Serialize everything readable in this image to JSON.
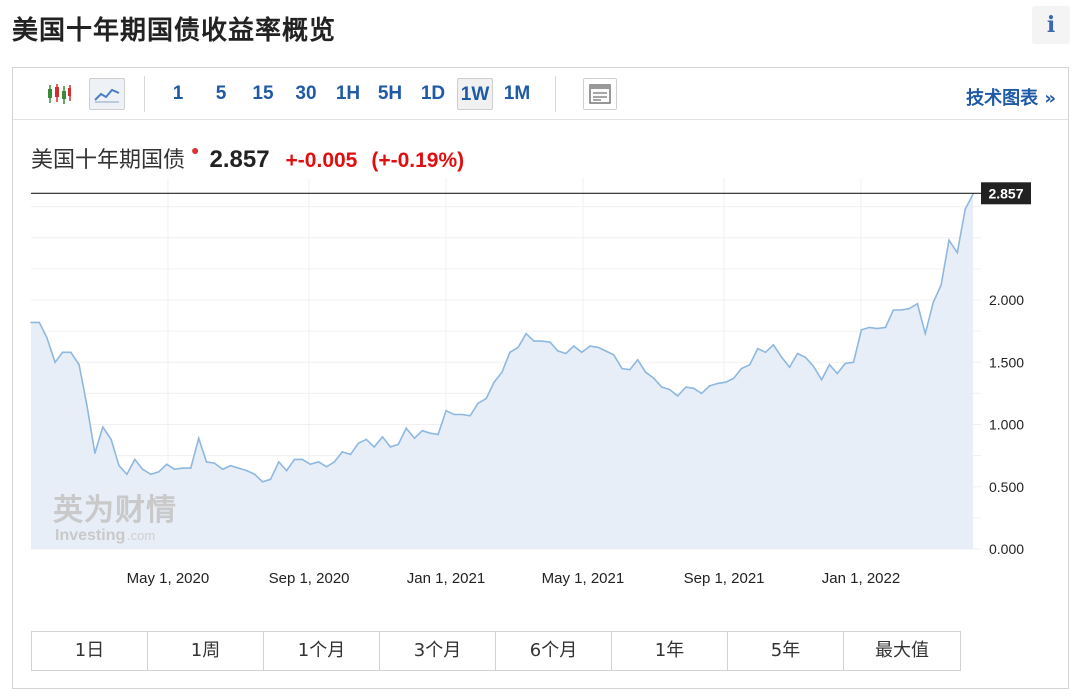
{
  "page": {
    "title": "美国十年期国债收益率概览",
    "info_glyph": "i"
  },
  "toolbar": {
    "intervals": [
      "1",
      "5",
      "15",
      "30",
      "1H",
      "5H",
      "1D",
      "1W",
      "1M"
    ],
    "active_interval": "1W",
    "tech_chart_label": "技术图表 »"
  },
  "quote": {
    "name": "美国十年期国债",
    "price": "2.857",
    "change": "+-0.005",
    "change_pct": "(+-0.19%)"
  },
  "range_buttons": [
    "1日",
    "1周",
    "1个月",
    "3个月",
    "6个月",
    "1年",
    "5年",
    "最大值"
  ],
  "watermark": {
    "cn": "英为财情",
    "en": "Investing",
    "en_suffix": ".com"
  },
  "colors": {
    "line": "#8fb8e0",
    "area": "#e7eef7",
    "up_red": "#e00f0f",
    "link_blue": "#1e5aa6",
    "price_label_bg": "#222222"
  },
  "chart_data": {
    "type": "area",
    "y_ticks": [
      "0.000",
      "0.500",
      "1.000",
      "1.500",
      "2.000"
    ],
    "ylim": [
      0,
      2.857
    ],
    "x_ticks": [
      {
        "label": "May 1, 2020",
        "t": 2020.33
      },
      {
        "label": "Sep 1, 2020",
        "t": 2020.67
      },
      {
        "label": "Jan 1, 2021",
        "t": 2021.0
      },
      {
        "label": "May 1, 2021",
        "t": 2021.33
      },
      {
        "label": "Sep 1, 2021",
        "t": 2021.67
      },
      {
        "label": "Jan 1, 2022",
        "t": 2022.0
      }
    ],
    "last_value_label": "2.857",
    "last_value": 2.857,
    "series": [
      {
        "t": [
          2020.0,
          2020.02,
          2020.038,
          2020.058,
          2020.076,
          2020.096,
          2020.116,
          2020.135,
          2020.154,
          2020.173,
          2020.193,
          2020.212,
          2020.231,
          2020.25,
          2020.269,
          2020.289,
          2020.308,
          2020.327,
          2020.346,
          2020.366,
          2020.385,
          2020.404,
          2020.423,
          2020.442,
          2020.462,
          2020.481,
          2020.5,
          2020.52,
          2020.539,
          2020.558,
          2020.577,
          2020.597,
          2020.616,
          2020.635,
          2020.654,
          2020.673,
          2020.693,
          2020.712,
          2020.731,
          2020.75,
          2020.77,
          2020.789,
          2020.808,
          2020.827,
          2020.847,
          2020.866,
          2020.885,
          2020.904,
          2020.924,
          2020.943,
          2020.962,
          2020.981,
          2021.0,
          2021.02,
          2021.039,
          2021.058,
          2021.077,
          2021.097,
          2021.116,
          2021.135,
          2021.154,
          2021.174,
          2021.193,
          2021.212,
          2021.231,
          2021.251,
          2021.27,
          2021.289,
          2021.308,
          2021.327,
          2021.347,
          2021.366,
          2021.385,
          2021.404,
          2021.424,
          2021.443,
          2021.462,
          2021.481,
          2021.501,
          2021.52,
          2021.539,
          2021.558,
          2021.578,
          2021.597,
          2021.616,
          2021.635,
          2021.655,
          2021.674,
          2021.693,
          2021.712,
          2021.732,
          2021.751,
          2021.77,
          2021.789,
          2021.809,
          2021.828,
          2021.847,
          2021.866,
          2021.885,
          2021.905,
          2021.924,
          2021.943,
          2021.962,
          2021.982,
          2022.001,
          2022.02,
          2022.039,
          2022.059,
          2022.078,
          2022.097,
          2022.116,
          2022.136,
          2022.155,
          2022.174,
          2022.193,
          2022.212,
          2022.232,
          2022.251,
          2022.27
        ],
        "values": [
          1.82,
          1.82,
          1.7,
          1.5,
          1.58,
          1.58,
          1.48,
          1.15,
          0.77,
          0.98,
          0.88,
          0.67,
          0.6,
          0.72,
          0.64,
          0.6,
          0.62,
          0.68,
          0.64,
          0.65,
          0.65,
          0.89,
          0.7,
          0.69,
          0.64,
          0.67,
          0.65,
          0.63,
          0.6,
          0.54,
          0.56,
          0.7,
          0.63,
          0.72,
          0.72,
          0.68,
          0.7,
          0.66,
          0.7,
          0.78,
          0.76,
          0.85,
          0.88,
          0.82,
          0.9,
          0.82,
          0.84,
          0.97,
          0.89,
          0.95,
          0.93,
          0.92,
          1.11,
          1.08,
          1.08,
          1.07,
          1.17,
          1.21,
          1.34,
          1.42,
          1.58,
          1.62,
          1.73,
          1.67,
          1.67,
          1.66,
          1.59,
          1.57,
          1.63,
          1.58,
          1.63,
          1.62,
          1.59,
          1.56,
          1.45,
          1.44,
          1.52,
          1.42,
          1.37,
          1.3,
          1.28,
          1.23,
          1.3,
          1.29,
          1.25,
          1.31,
          1.33,
          1.34,
          1.37,
          1.45,
          1.48,
          1.61,
          1.58,
          1.64,
          1.54,
          1.46,
          1.57,
          1.54,
          1.47,
          1.36,
          1.48,
          1.41,
          1.49,
          1.5,
          1.76,
          1.78,
          1.77,
          1.78,
          1.92,
          1.92,
          1.93,
          1.97,
          1.73,
          1.98,
          2.12,
          2.48,
          2.38,
          2.73,
          2.85
        ]
      }
    ]
  }
}
